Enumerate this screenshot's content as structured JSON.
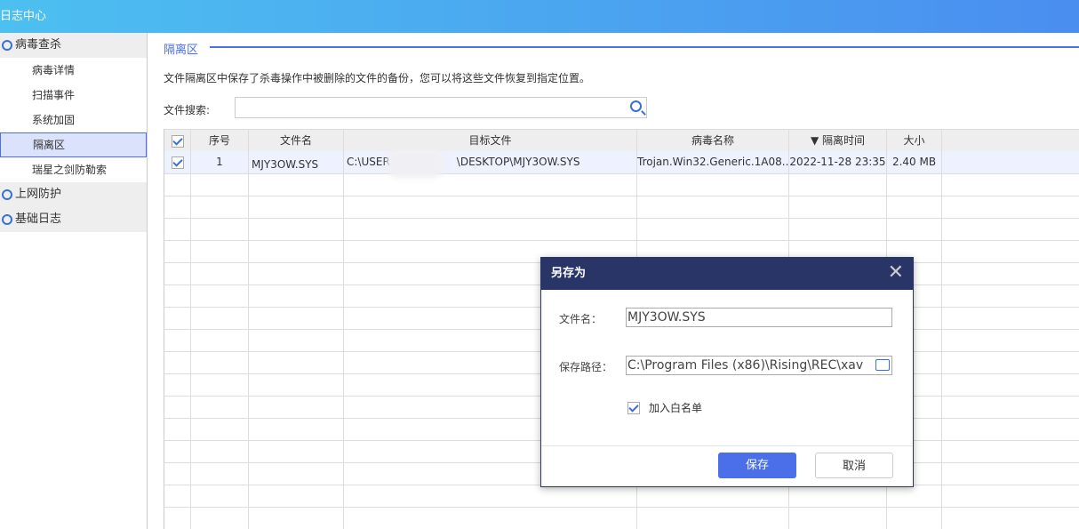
{
  "window": {
    "title": "日志中心"
  },
  "sidebar": {
    "groups": [
      {
        "label": "病毒查杀",
        "icon": "virus-scan-icon",
        "items": [
          "病毒详情",
          "扫描事件",
          "系统加固",
          "隔离区",
          "瑞星之剑防勒索"
        ]
      },
      {
        "label": "上网防护",
        "icon": "web-protect-icon"
      },
      {
        "label": "基础日志",
        "icon": "basic-log-icon"
      }
    ],
    "selected": "隔离区"
  },
  "main": {
    "section_title": "隔离区",
    "description": "文件隔离区中保存了杀毒操作中被删除的文件的备份，您可以将这些文件恢复到指定位置。",
    "search_label": "文件搜索:",
    "search_value": "",
    "columns": [
      "序号",
      "文件名",
      "目标文件",
      "病毒名称",
      "▼ 隔离时间",
      "大小"
    ],
    "rows": [
      {
        "checked": true,
        "index": "1",
        "file_name": "MJY3OW.SYS",
        "target": "C:\\USER",
        "target_suffix": "\\DESKTOP\\MJY3OW.SYS",
        "virus": "Trojan.Win32.Generic.1A08...",
        "time": "2022-11-28 23:35",
        "size": "2.40 MB"
      }
    ]
  },
  "dialog": {
    "title": "另存为",
    "filename_label": "文件名：",
    "filename_value": "MJY3OW.SYS",
    "path_label": "保存路径：",
    "path_value": "C:\\Program Files (x86)\\Rising\\REC\\xav",
    "whitelist_label": "加入白名单",
    "whitelist_checked": true,
    "save_label": "保存",
    "cancel_label": "取消",
    "accent": "#4a6fe8"
  }
}
